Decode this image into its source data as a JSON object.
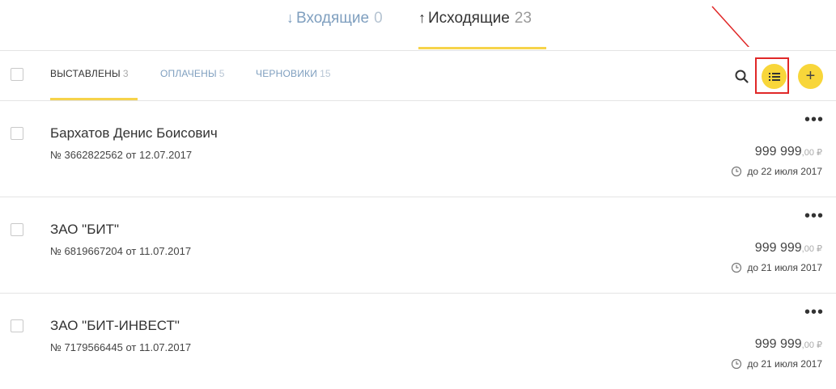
{
  "top_tabs": {
    "incoming": {
      "label": "Входящие",
      "count": "0",
      "icon": "arrow-down-icon"
    },
    "outgoing": {
      "label": "Исходящие",
      "count": "23",
      "icon": "arrow-up-icon"
    }
  },
  "filter_tabs": {
    "issued": {
      "label": "ВЫСТАВЛЕНЫ",
      "count": "3"
    },
    "paid": {
      "label": "ОПЛАЧЕНЫ",
      "count": "5"
    },
    "drafts": {
      "label": "ЧЕРНОВИКИ",
      "count": "15"
    }
  },
  "toolbar": {
    "add_label": "+"
  },
  "colors": {
    "accent": "#f8d63a",
    "link": "#7f9fbf",
    "annotation": "#e02828"
  },
  "invoices": [
    {
      "name": "Бархатов Денис Боисович",
      "meta": "№ 3662822562 от 12.07.2017",
      "amount": "999 999",
      "cents": ",00 ₽",
      "due": "до 22 июля 2017"
    },
    {
      "name": "ЗАО \"БИТ\"",
      "meta": "№ 6819667204 от 11.07.2017",
      "amount": "999 999",
      "cents": ",00 ₽",
      "due": "до 21 июля 2017"
    },
    {
      "name": "ЗАО \"БИТ-ИНВЕСТ\"",
      "meta": "№ 7179566445 от 11.07.2017",
      "amount": "999 999",
      "cents": ",00 ₽",
      "due": "до 21 июля 2017"
    }
  ]
}
